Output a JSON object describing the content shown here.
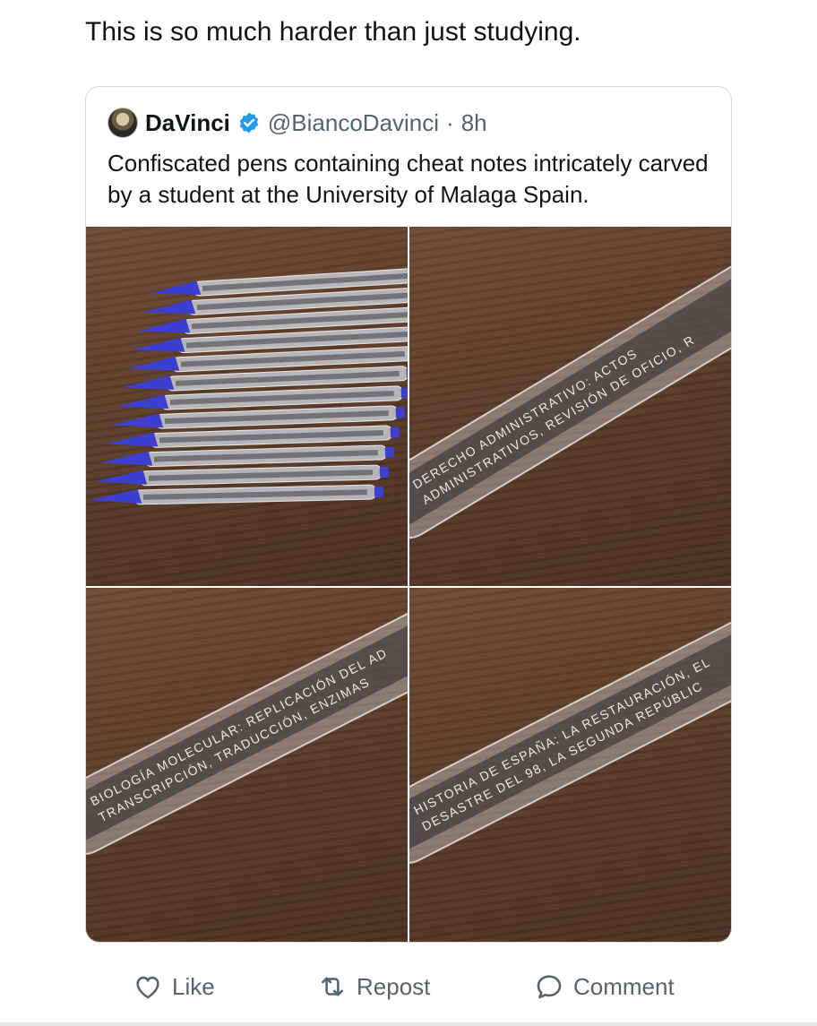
{
  "post": {
    "text": "This is so much harder than just studying."
  },
  "quote": {
    "author_name": "DaVinci",
    "handle": "@BiancoDavinci",
    "separator": "·",
    "time": "8h",
    "verified_color": "#1d9bf0",
    "text": "Confiscated pens containing cheat notes intricately carved by a student at the University of Malaga Spain.",
    "media": [
      {
        "caption": ""
      },
      {
        "engraving": [
          "DERECHO ADMINISTRATIVO: ACTOS",
          "ADMINISTRATIVOS, REVISIÓN DE OFICIO, R"
        ]
      },
      {
        "engraving": [
          "BIOLOGÍA MOLECULAR: REPLICACIÓN DEL AD",
          "TRANSCRIPCIÓN, TRADUCCIÓN, ENZIMAS"
        ]
      },
      {
        "engraving": [
          "HISTORIA DE ESPAÑA: LA RESTAURACIÓN, EL",
          "DESASTRE DEL 98, LA SEGUNDA REPÚBLIC"
        ]
      }
    ]
  },
  "actions": {
    "like_label": "Like",
    "repost_label": "Repost",
    "comment_label": "Comment"
  },
  "icons": {
    "like": "heart-icon",
    "repost": "repost-icon",
    "comment": "speech-bubble-icon",
    "verified": "verified-badge-icon"
  },
  "colors": {
    "text_primary": "#0f1419",
    "text_secondary": "#536471",
    "pen_cap": "#3d3fd1",
    "border": "#cfd9de"
  }
}
